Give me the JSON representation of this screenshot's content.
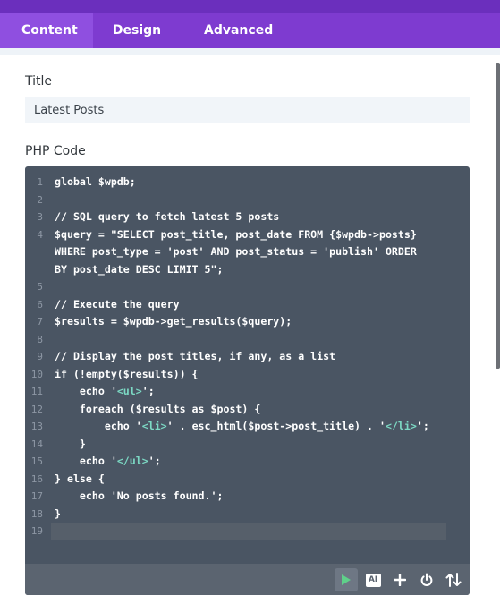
{
  "tabs": [
    {
      "label": "Content",
      "active": true
    },
    {
      "label": "Design",
      "active": false
    },
    {
      "label": "Advanced",
      "active": false
    }
  ],
  "title_section": {
    "label": "Title",
    "value": "Latest Posts"
  },
  "php_section": {
    "label": "PHP Code"
  },
  "editor": {
    "lines": [
      {
        "n": "1",
        "segments": [
          {
            "t": "global $wpdb;",
            "c": "plain"
          }
        ]
      },
      {
        "n": "2",
        "segments": []
      },
      {
        "n": "3",
        "segments": [
          {
            "t": "// SQL query to fetch latest 5 posts",
            "c": "plain"
          }
        ]
      },
      {
        "n": "4",
        "segments": [
          {
            "t": "$query = \"SELECT post_title, post_date FROM {$wpdb->posts}",
            "c": "plain"
          }
        ]
      },
      {
        "n": "",
        "segments": [
          {
            "t": "WHERE post_type = 'post' AND post_status = 'publish' ORDER",
            "c": "plain"
          }
        ]
      },
      {
        "n": "",
        "segments": [
          {
            "t": "BY post_date DESC LIMIT 5\";",
            "c": "plain"
          }
        ]
      },
      {
        "n": "5",
        "segments": []
      },
      {
        "n": "6",
        "segments": [
          {
            "t": "// Execute the query",
            "c": "plain"
          }
        ]
      },
      {
        "n": "7",
        "segments": [
          {
            "t": "$results = $wpdb->get_results($query);",
            "c": "plain"
          }
        ]
      },
      {
        "n": "8",
        "segments": []
      },
      {
        "n": "9",
        "segments": [
          {
            "t": "// Display the post titles, if any, as a list",
            "c": "plain"
          }
        ]
      },
      {
        "n": "10",
        "segments": [
          {
            "t": "if (!empty($results)) {",
            "c": "plain"
          }
        ]
      },
      {
        "n": "11",
        "segments": [
          {
            "t": "    echo '",
            "c": "plain"
          },
          {
            "t": "<ul>",
            "c": "tag"
          },
          {
            "t": "';",
            "c": "plain"
          }
        ]
      },
      {
        "n": "12",
        "segments": [
          {
            "t": "    foreach ($results as $post) {",
            "c": "plain"
          }
        ]
      },
      {
        "n": "13",
        "segments": [
          {
            "t": "        echo '",
            "c": "plain"
          },
          {
            "t": "<li>",
            "c": "tag"
          },
          {
            "t": "' . esc_html($post->post_title) . '",
            "c": "plain"
          },
          {
            "t": "</li>",
            "c": "tag"
          },
          {
            "t": "';",
            "c": "plain"
          }
        ]
      },
      {
        "n": "14",
        "segments": [
          {
            "t": "    }",
            "c": "plain"
          }
        ]
      },
      {
        "n": "15",
        "segments": [
          {
            "t": "    echo '",
            "c": "plain"
          },
          {
            "t": "</ul>",
            "c": "tag"
          },
          {
            "t": "';",
            "c": "plain"
          }
        ]
      },
      {
        "n": "16",
        "segments": [
          {
            "t": "} else {",
            "c": "plain"
          }
        ]
      },
      {
        "n": "17",
        "segments": [
          {
            "t": "    echo 'No posts found.';",
            "c": "plain"
          }
        ]
      },
      {
        "n": "18",
        "segments": [
          {
            "t": "}",
            "c": "plain"
          }
        ]
      },
      {
        "n": "19",
        "segments": []
      }
    ]
  },
  "toolbar": {
    "buttons": [
      {
        "icon": "play-icon"
      },
      {
        "icon": "ai-icon",
        "label": "AI"
      },
      {
        "icon": "plus-icon"
      },
      {
        "icon": "power-icon"
      },
      {
        "icon": "sort-arrows-icon"
      }
    ]
  },
  "colors": {
    "tab_bar": "#7e3bd0",
    "active_tab": "#8f4fe0",
    "editor_bg": "#4a5563",
    "toolbar_bg": "#5b6470",
    "tag_text": "#7cd9c4",
    "play_green": "#5fd08a"
  }
}
